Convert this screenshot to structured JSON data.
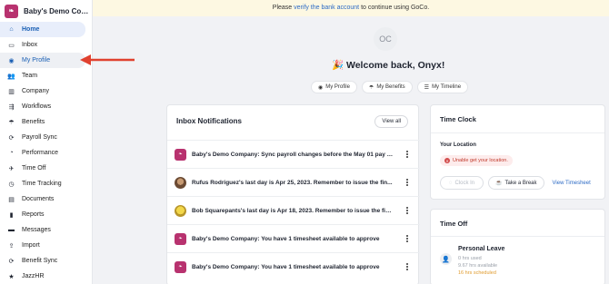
{
  "brand": {
    "name": "Baby's Demo Comp...",
    "logo_text": "GoCo"
  },
  "sidebar": {
    "items": [
      {
        "label": "Home",
        "icon": "home-icon",
        "state": "active"
      },
      {
        "label": "Inbox",
        "icon": "inbox-icon",
        "state": ""
      },
      {
        "label": "My Profile",
        "icon": "user-circle-icon",
        "state": "hover"
      },
      {
        "label": "Team",
        "icon": "team-icon",
        "state": ""
      },
      {
        "label": "Company",
        "icon": "building-icon",
        "state": ""
      },
      {
        "label": "Workflows",
        "icon": "workflow-icon",
        "state": ""
      },
      {
        "label": "Benefits",
        "icon": "umbrella-icon",
        "state": ""
      },
      {
        "label": "Payroll Sync",
        "icon": "sync-icon",
        "state": ""
      },
      {
        "label": "Performance",
        "icon": "gauge-icon",
        "state": ""
      },
      {
        "label": "Time Off",
        "icon": "plane-icon",
        "state": ""
      },
      {
        "label": "Time Tracking",
        "icon": "clock-icon",
        "state": ""
      },
      {
        "label": "Documents",
        "icon": "document-icon",
        "state": ""
      },
      {
        "label": "Reports",
        "icon": "bar-chart-icon",
        "state": ""
      },
      {
        "label": "Messages",
        "icon": "message-icon",
        "state": ""
      },
      {
        "label": "Import",
        "icon": "import-icon",
        "state": ""
      },
      {
        "label": "Benefit Sync",
        "icon": "sync-icon",
        "state": ""
      },
      {
        "label": "JazzHR",
        "icon": "star-icon",
        "state": ""
      }
    ]
  },
  "banner": {
    "prefix": "Please ",
    "link": "verify the bank account",
    "suffix": " to continue using GoCo."
  },
  "welcome": {
    "initials": "OC",
    "title": "Welcome back, Onyx!",
    "emoji": "🎉"
  },
  "quick_links": [
    {
      "label": "My Profile",
      "icon": "user-icon"
    },
    {
      "label": "My Benefits",
      "icon": "umbrella-icon"
    },
    {
      "label": "My Timeline",
      "icon": "list-icon"
    }
  ],
  "inbox": {
    "title": "Inbox Notifications",
    "view_all": "View all",
    "notifications": [
      {
        "text": "Baby's Demo Company: Sync payroll changes before the May 01 pay d...",
        "avatar": "logo"
      },
      {
        "text": "Rufus Rodriguez's last day is Apr 25, 2023. Remember to issue the fin...",
        "avatar": "photo1"
      },
      {
        "text": "Bob Squarepants's last day is Apr 18, 2023. Remember to issue the fin...",
        "avatar": "photo2"
      },
      {
        "text": "Baby's Demo Company: You have 1 timesheet available to approve",
        "avatar": "logo"
      },
      {
        "text": "Baby's Demo Company: You have 1 timesheet available to approve",
        "avatar": "logo"
      }
    ]
  },
  "time_clock": {
    "title": "Time Clock",
    "location_label": "Your Location",
    "warning": "Unable get your location.",
    "clock_in": "Clock In",
    "take_break": "Take a Break",
    "view_timesheet": "View Timesheet"
  },
  "time_off": {
    "title": "Time Off",
    "policy": "Personal Leave",
    "used": "0 hrs used",
    "available": "9.67 hrs available",
    "scheduled": "16 hrs scheduled"
  },
  "colors": {
    "accent": "#1a5fb4",
    "brand": "#b8326f",
    "annotation_arrow": "#e0412f",
    "banner_bg": "#fdf8e2"
  }
}
